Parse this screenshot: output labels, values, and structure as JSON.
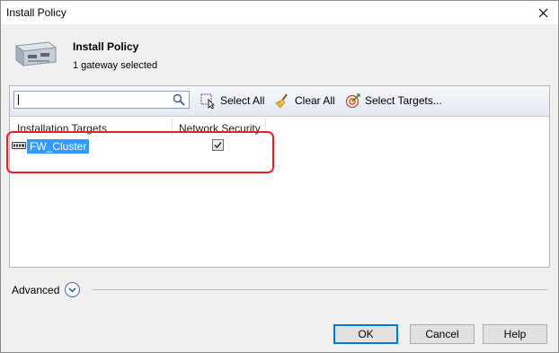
{
  "window": {
    "title": "Install Policy"
  },
  "header": {
    "title": "Install Policy",
    "subtitle": "1 gateway selected"
  },
  "toolbar": {
    "search_value": "",
    "select_all_label": "Select All",
    "clear_all_label": "Clear All",
    "select_targets_label": "Select Targets..."
  },
  "table": {
    "columns": [
      "Installation Targets",
      "Network Security"
    ],
    "rows": [
      {
        "name": "FW_Cluster",
        "network_security_checked": true,
        "selected": true
      }
    ]
  },
  "advanced": {
    "label": "Advanced"
  },
  "buttons": {
    "ok": "OK",
    "cancel": "Cancel",
    "help": "Help"
  },
  "colors": {
    "selection": "#3399ff",
    "highlight_border": "#e8202a",
    "default_button_border": "#0078d7"
  }
}
